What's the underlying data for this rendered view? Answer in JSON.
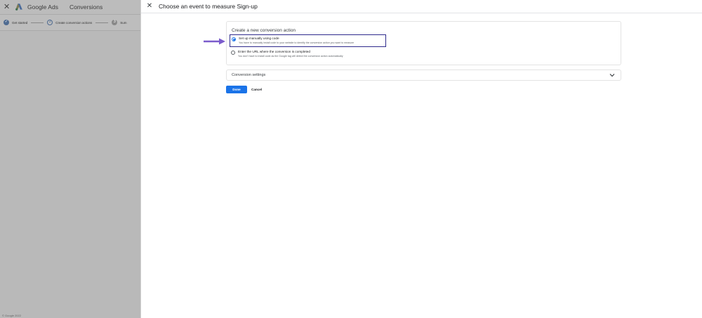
{
  "background": {
    "brand": "Google Ads",
    "page_title": "Conversions",
    "steps": [
      {
        "label": "Get started",
        "state": "done"
      },
      {
        "label": "Create conversion actions",
        "state": "current",
        "number": "2"
      },
      {
        "label": "Sum",
        "state": "pending",
        "number": "3"
      }
    ],
    "footer": "© Google 2022"
  },
  "dialog": {
    "title": "Choose an event to measure Sign-up",
    "card_title": "Create a new conversion action",
    "options": [
      {
        "label": "Set up manually using code",
        "description": "You have to manually install code to your website to identify the conversion action you want to measure",
        "selected": true
      },
      {
        "label": "Enter the URL where the conversion is completed",
        "description": "You don't have to install code as the Google tag will detect the conversion action automatically",
        "selected": false
      }
    ],
    "settings_label": "Conversion settings",
    "done_label": "Done",
    "cancel_label": "Cancel"
  },
  "colors": {
    "accent": "#1a73e8",
    "highlight_border": "#2e2a8c",
    "arrow": "#7b5ccc"
  }
}
